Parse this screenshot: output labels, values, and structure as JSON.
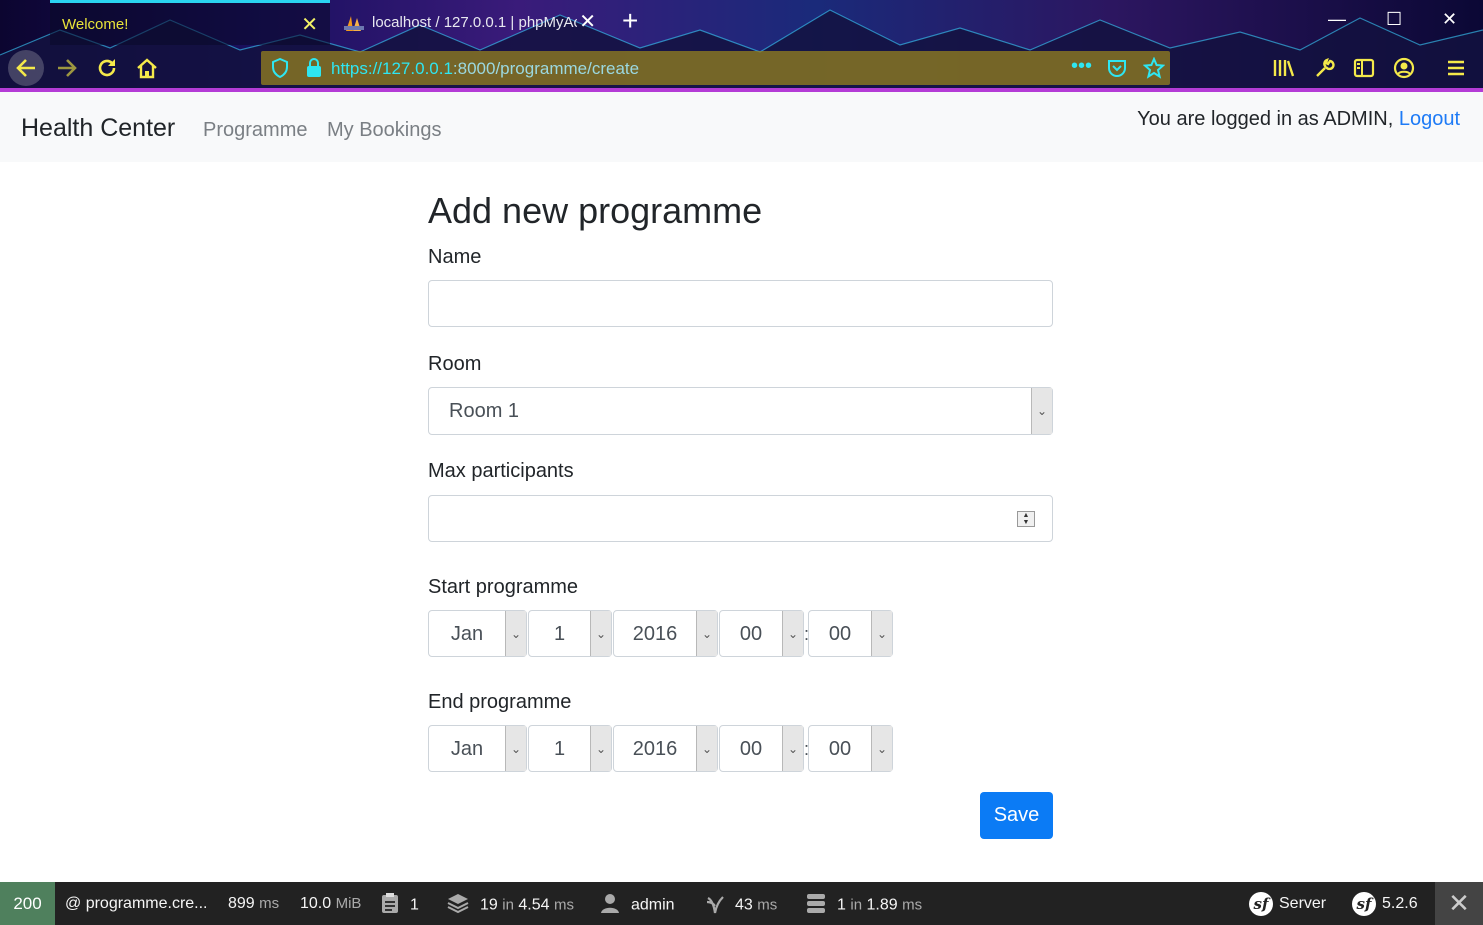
{
  "browser": {
    "tabs": [
      {
        "label": "Welcome!",
        "active": true
      },
      {
        "label": "localhost / 127.0.0.1 | phpMyAc",
        "active": false
      }
    ],
    "url_host": "https://127.0.0.1",
    "url_path": ":8000/programme/create"
  },
  "navbar": {
    "brand": "Health Center",
    "links": [
      "Programme",
      "My Bookings"
    ],
    "login_text": "You are logged in as ADMIN,",
    "logout_label": "Logout"
  },
  "form": {
    "title": "Add new programme",
    "name_label": "Name",
    "name_value": "",
    "room_label": "Room",
    "room_value": "Room 1",
    "max_label": "Max participants",
    "max_value": "",
    "start_label": "Start programme",
    "start": {
      "month": "Jan",
      "day": "1",
      "year": "2016",
      "hour": "00",
      "minute": "00"
    },
    "end_label": "End programme",
    "end": {
      "month": "Jan",
      "day": "1",
      "year": "2016",
      "hour": "00",
      "minute": "00"
    },
    "colon": ":",
    "save_label": "Save"
  },
  "toolbar": {
    "status": "200",
    "route": "@ programme.cre...",
    "time_value": "899",
    "time_unit": "ms",
    "memory_value": "10.0",
    "memory_unit": "MiB",
    "logs": "1",
    "cache_value": "19",
    "cache_in": "in",
    "cache_time": "4.54",
    "cache_unit": "ms",
    "user": "admin",
    "twig_value": "43",
    "twig_unit": "ms",
    "db_value": "1",
    "db_in": "in",
    "db_time": "1.89",
    "db_unit": "ms",
    "server_label": "Server",
    "version": "5.2.6"
  },
  "colors": {
    "accent_tab": "#2ad4f0",
    "link": "#1e7bf6",
    "primary_button": "#0b7bf5",
    "status_ok": "#4f805d"
  }
}
